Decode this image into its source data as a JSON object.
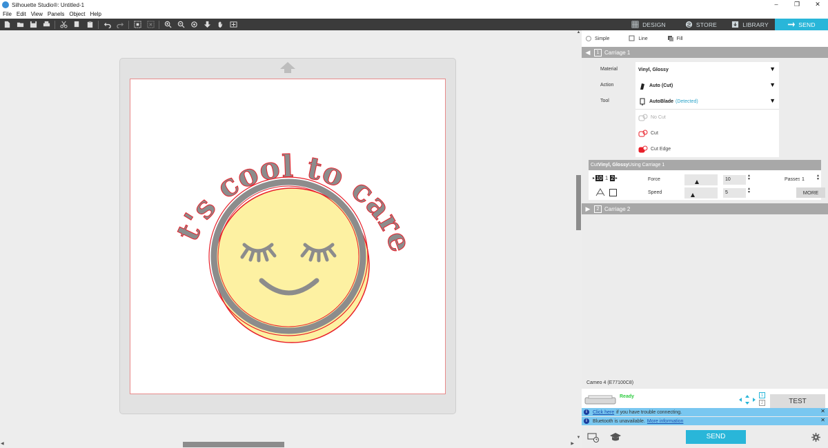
{
  "window": {
    "title": "Silhouette Studio®: Untitled-1",
    "minimize": "–",
    "maximize": "❐",
    "close": "✕"
  },
  "menu": [
    "File",
    "Edit",
    "View",
    "Panels",
    "Object",
    "Help"
  ],
  "nav_tabs": [
    {
      "label": "DESIGN",
      "icon": "grid-icon"
    },
    {
      "label": "STORE",
      "icon": "store-icon"
    },
    {
      "label": "LIBRARY",
      "icon": "library-icon"
    },
    {
      "label": "SEND",
      "icon": "send-icon",
      "active": true
    }
  ],
  "design": {
    "arc_text": "it's cool to care",
    "text_color": "#8c8c8c",
    "outline_color": "#e8202a",
    "face_color": "#fdf1a2",
    "mat_arrow": "up-arrow-icon"
  },
  "panel": {
    "modes": [
      "Simple",
      "Line",
      "Fill"
    ],
    "carriage1": {
      "number": "1",
      "label": "Carriage 1"
    },
    "carriage2": {
      "number": "2",
      "label": "Carriage 2"
    },
    "material": {
      "label": "Material",
      "value": "Vinyl, Glossy"
    },
    "action": {
      "label": "Action",
      "value": "Auto (Cut)"
    },
    "tool": {
      "label": "Tool",
      "value": "AutoBlade",
      "status": "(Detected)"
    },
    "cut_types": [
      "No Cut",
      "Cut",
      "Cut Edge"
    ],
    "cut_header": {
      "prefix": "Cut ",
      "material": "Vinyl, Glossy",
      "suffix": " Using Carriage 1"
    },
    "blade_cells": [
      "10",
      "1",
      "2"
    ],
    "force": {
      "label": "Force",
      "value": "10",
      "level": 10,
      "max": 33
    },
    "speed": {
      "label": "Speed",
      "value": "5",
      "level": 5,
      "max": 30
    },
    "passes": {
      "label": "Passes",
      "value": "1"
    },
    "more_label": "MORE",
    "device_name": "Cameo 4 (E77100C8)",
    "status": "Ready",
    "test_label": "TEST",
    "info1": {
      "link": "Click here",
      "text": "if you have trouble connecting."
    },
    "info2": {
      "text": "Bluetooth is unavailable.",
      "link": "More information"
    },
    "send_label": "SEND",
    "tray_numbers": [
      "1",
      "2"
    ]
  }
}
